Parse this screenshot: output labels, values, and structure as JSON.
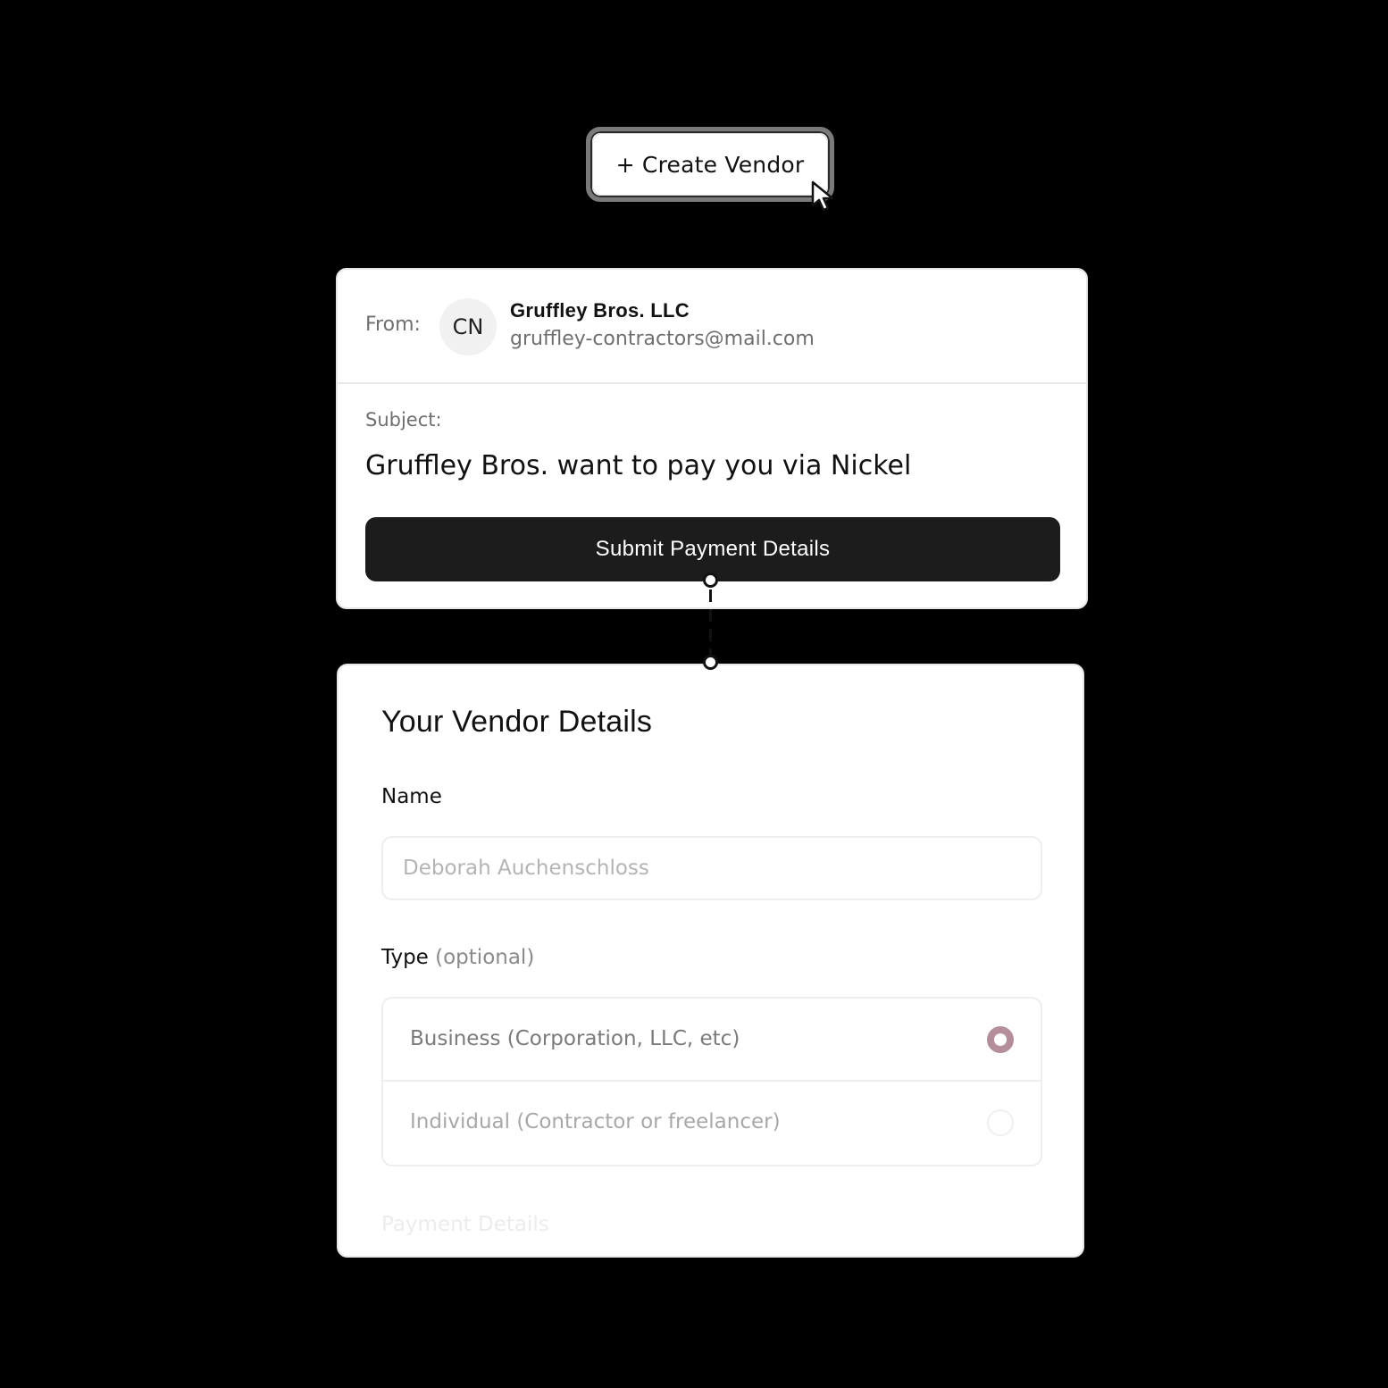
{
  "create_vendor": {
    "label": "+ Create Vendor"
  },
  "email": {
    "from_label": "From:",
    "avatar_initials": "CN",
    "sender_name": "Gruffley Bros. LLC",
    "sender_email": "gruffley-contractors@mail.com",
    "subject_label": "Subject:",
    "subject": "Gruffley Bros. want to pay you via Nickel",
    "submit_label": "Submit Payment Details"
  },
  "vendor_form": {
    "title": "Your Vendor Details",
    "name_label": "Name",
    "name_placeholder": "Deborah Auchenschloss",
    "type_label": "Type",
    "type_optional": "(optional)",
    "type_options": [
      {
        "label": "Business (Corporation, LLC, etc)",
        "selected": true
      },
      {
        "label": "Individual (Contractor or freelancer)",
        "selected": false
      }
    ],
    "payment_heading": "Payment Details"
  },
  "colors": {
    "background": "#000000",
    "button_dark": "#1c1c1c",
    "radio_accent": "#b48e9a"
  },
  "icons": {
    "cursor": "cursor-arrow-icon"
  }
}
